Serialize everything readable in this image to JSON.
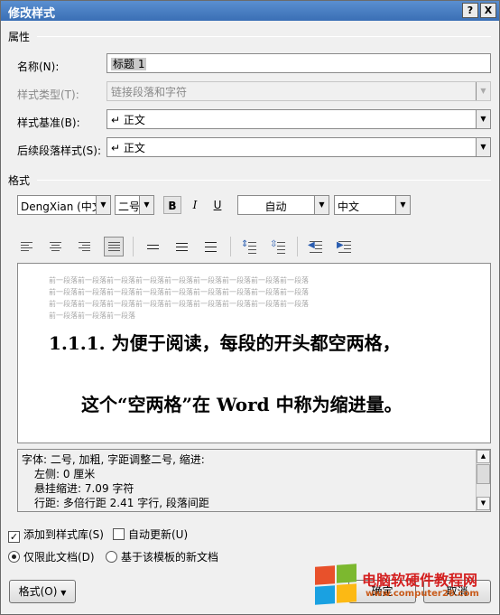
{
  "window": {
    "title": "修改样式",
    "help": "?",
    "close": "X"
  },
  "properties": {
    "heading": "属性",
    "name_label": "名称(N):",
    "name_value": "标题 1",
    "type_label": "样式类型(T):",
    "type_value": "链接段落和字符",
    "based_label": "样式基准(B):",
    "based_value": "↵ 正文",
    "next_label": "后续段落样式(S):",
    "next_value": "↵ 正文"
  },
  "format": {
    "heading": "格式",
    "font": "DengXian (中文",
    "size": "二号",
    "bold": "B",
    "italic": "I",
    "underline": "U",
    "color": "自动",
    "language": "中文"
  },
  "preview": {
    "prev_lines": [
      "前一段落前一段落前一段落前一段落前一段落前一段落前一段落前一段落前一段落",
      "前一段落前一段落前一段落前一段落前一段落前一段落前一段落前一段落前一段落",
      "前一段落前一段落前一段落前一段落前一段落前一段落前一段落前一段落前一段落",
      "前一段落前一段落前一段落"
    ],
    "line1": "1.1.1. 为便于阅读，每段的开头都空两格，",
    "line2": "这个“空两格”在 Word 中称为缩进量。"
  },
  "description": {
    "line1": "字体: 二号, 加粗, 字距调整二号, 缩进:",
    "line2": "左侧:  0 厘米",
    "line3": "悬挂缩进: 7.09 字符",
    "line4": "行距: 多倍行距 2.41 字行, 段落间距"
  },
  "options": {
    "add_gallery": "添加到样式库(S)",
    "auto_update": "自动更新(U)",
    "only_doc": "仅限此文档(D)",
    "new_docs": "基于该模板的新文档"
  },
  "buttons": {
    "format": "格式(O)",
    "ok": "确定",
    "cancel": "取消"
  },
  "watermark": {
    "text": "电脑软硬件教程网",
    "url": "www.computer26.com"
  }
}
